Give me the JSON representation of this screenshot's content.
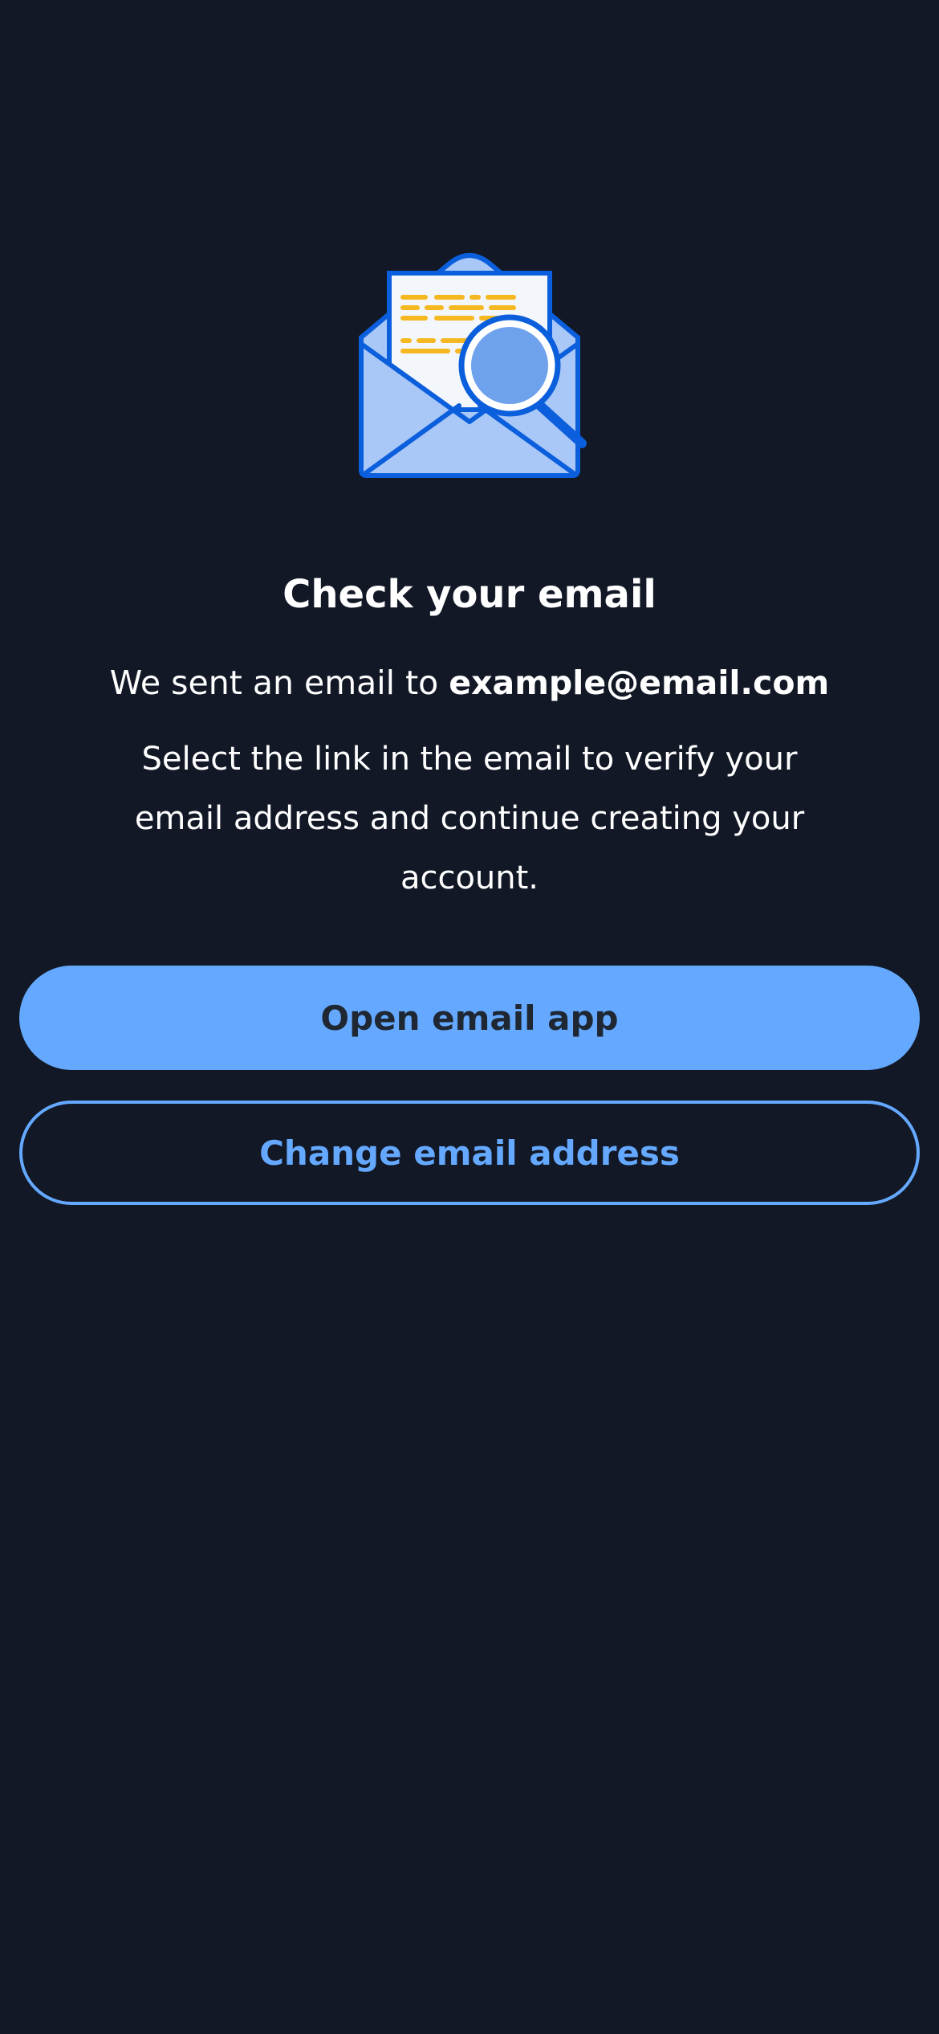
{
  "illustration": {
    "icon": "envelope-magnifier-icon",
    "colors": {
      "envelope_fill": "#a9c8f7",
      "outline": "#0b5fdc",
      "letter": "#f3f6fb",
      "text_lines": "#f5b820",
      "lens": "#6ea2ec"
    }
  },
  "heading": {
    "title": "Check your email"
  },
  "message": {
    "sent_prefix": "We sent an email to ",
    "email": "example@email.com",
    "instructions": "Select the link in the email to verify your email address and continue creating your account."
  },
  "actions": {
    "primary_label": "Open email app",
    "secondary_label": "Change email address"
  },
  "theme": {
    "background": "#121826",
    "accent": "#64a9ff",
    "primary_text": "#1f2733"
  }
}
